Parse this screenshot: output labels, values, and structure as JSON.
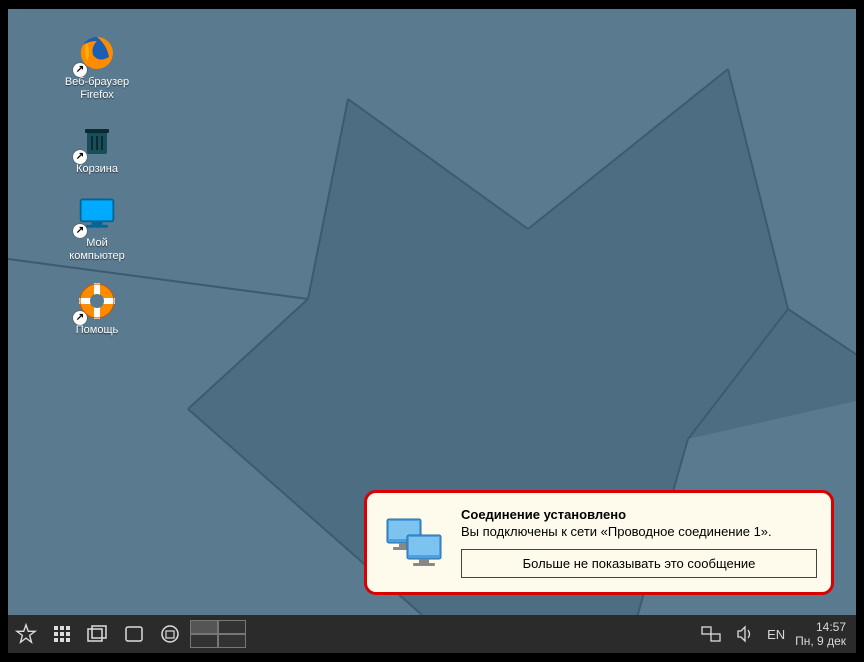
{
  "desktop": {
    "icons": [
      {
        "label": "Веб-браузер\nFirefox"
      },
      {
        "label": "Корзина"
      },
      {
        "label": "Мой\nкомпьютер"
      },
      {
        "label": "Помощь"
      }
    ]
  },
  "notification": {
    "title": "Соединение установлено",
    "message": "Вы подключены к сети «Проводное соединение 1».",
    "button": "Больше не показывать это сообщение"
  },
  "taskbar": {
    "language": "EN",
    "time": "14:57",
    "date": "Пн, 9 дек"
  }
}
